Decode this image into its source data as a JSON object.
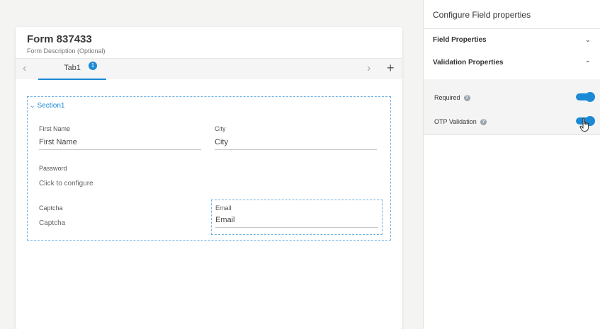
{
  "form": {
    "title": "Form 837433",
    "description": "Form Description (Optional)",
    "tabs": [
      {
        "label": "Tab1",
        "badge": "1"
      }
    ],
    "section": {
      "title": "Section1",
      "fields": {
        "first_name": {
          "label": "First Name",
          "value": "First Name"
        },
        "city": {
          "label": "City",
          "value": "City"
        },
        "password": {
          "label": "Password",
          "value": "Click to configure"
        },
        "captcha": {
          "label": "Captcha",
          "value": "Captcha"
        },
        "email": {
          "label": "Email",
          "value": "Email"
        }
      }
    },
    "icons": {
      "prev": "chevron-left-icon",
      "next": "chevron-right-icon",
      "add": "plus-icon"
    }
  },
  "panel": {
    "title": "Configure Field properties",
    "accordions": [
      {
        "label": "Field Properties",
        "expanded": false
      },
      {
        "label": "Validation Properties",
        "expanded": true
      }
    ],
    "validation": [
      {
        "label": "Required",
        "enabled": true
      },
      {
        "label": "OTP Validation",
        "enabled": true
      }
    ]
  },
  "colors": {
    "accent": "#1b8ad6",
    "canvas": "#f4f4f2",
    "panel": "#ffffff"
  }
}
